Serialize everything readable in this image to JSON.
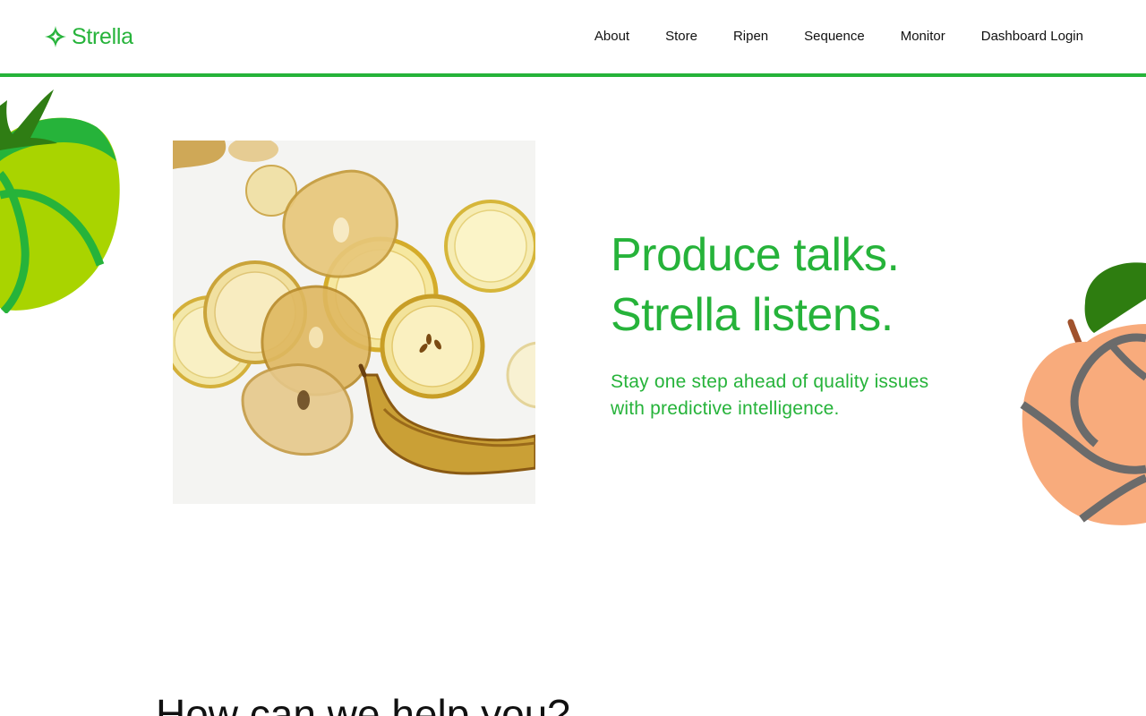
{
  "brand": {
    "name": "Strella",
    "logo_icon": "strella-star-icon",
    "accent_color": "#26b33a"
  },
  "nav": {
    "items": [
      {
        "label": "About"
      },
      {
        "label": "Store"
      },
      {
        "label": "Ripen"
      },
      {
        "label": "Sequence"
      },
      {
        "label": "Monitor"
      },
      {
        "label": "Dashboard Login"
      }
    ]
  },
  "hero": {
    "title_line1": "Produce talks.",
    "title_line2": "Strella listens.",
    "subtitle_line1": "Stay one step ahead of quality issues",
    "subtitle_line2": "with predictive intelligence.",
    "image_icon": "sliced-fruit-photo"
  },
  "decorations": {
    "left": "apple-illustration",
    "right": "peach-illustration"
  },
  "help": {
    "heading": "How can we help you?"
  }
}
